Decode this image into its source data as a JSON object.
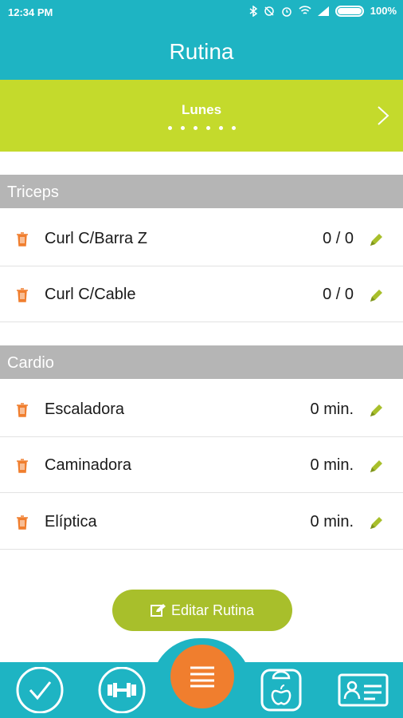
{
  "status": {
    "time": "12:34 PM",
    "battery": "100%"
  },
  "header": {
    "title": "Rutina"
  },
  "day_selector": {
    "day": "Lunes",
    "pages": 6,
    "current_page": 1
  },
  "sections": [
    {
      "title": "Triceps",
      "items": [
        {
          "name": "Curl C/Barra Z",
          "value": "0 / 0"
        },
        {
          "name": "Curl C/Cable",
          "value": "0 / 0"
        }
      ]
    },
    {
      "title": "Cardio",
      "items": [
        {
          "name": "Escaladora",
          "value": "0 min."
        },
        {
          "name": "Caminadora",
          "value": "0 min."
        },
        {
          "name": "Elíptica",
          "value": "0 min."
        }
      ]
    }
  ],
  "edit_button": {
    "label": "Editar Rutina"
  },
  "nav": {
    "items": [
      "check-icon",
      "dumbbell-icon",
      "menu-icon",
      "scale-icon",
      "profile-card-icon"
    ],
    "active": "menu-icon"
  },
  "colors": {
    "primary": "#1eb4c3",
    "accent": "#c4da2c",
    "button": "#a8bf2b",
    "trash": "#f07e2e",
    "center": "#f07e2e"
  }
}
